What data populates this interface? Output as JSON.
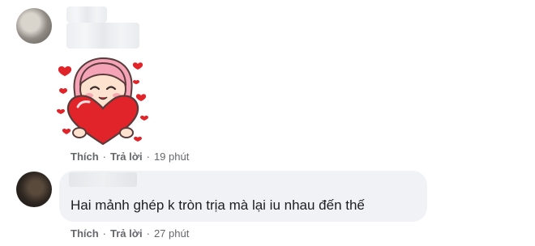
{
  "comments": [
    {
      "like_label": "Thích",
      "reply_label": "Trả lời",
      "separator": "·",
      "time": "19 phút",
      "sticker_icon": "girl-hugging-heart-sticker"
    },
    {
      "text": "Hai mảnh ghép k tròn trịa mà lại iu nhau đến thế",
      "like_label": "Thích",
      "reply_label": "Trả lời",
      "separator": "·",
      "time": "27 phút"
    }
  ],
  "colors": {
    "bubble_bg": "#f0f2f5",
    "meta_text": "#65676b",
    "body_text": "#1c1e21",
    "heart_red": "#e0242a"
  }
}
